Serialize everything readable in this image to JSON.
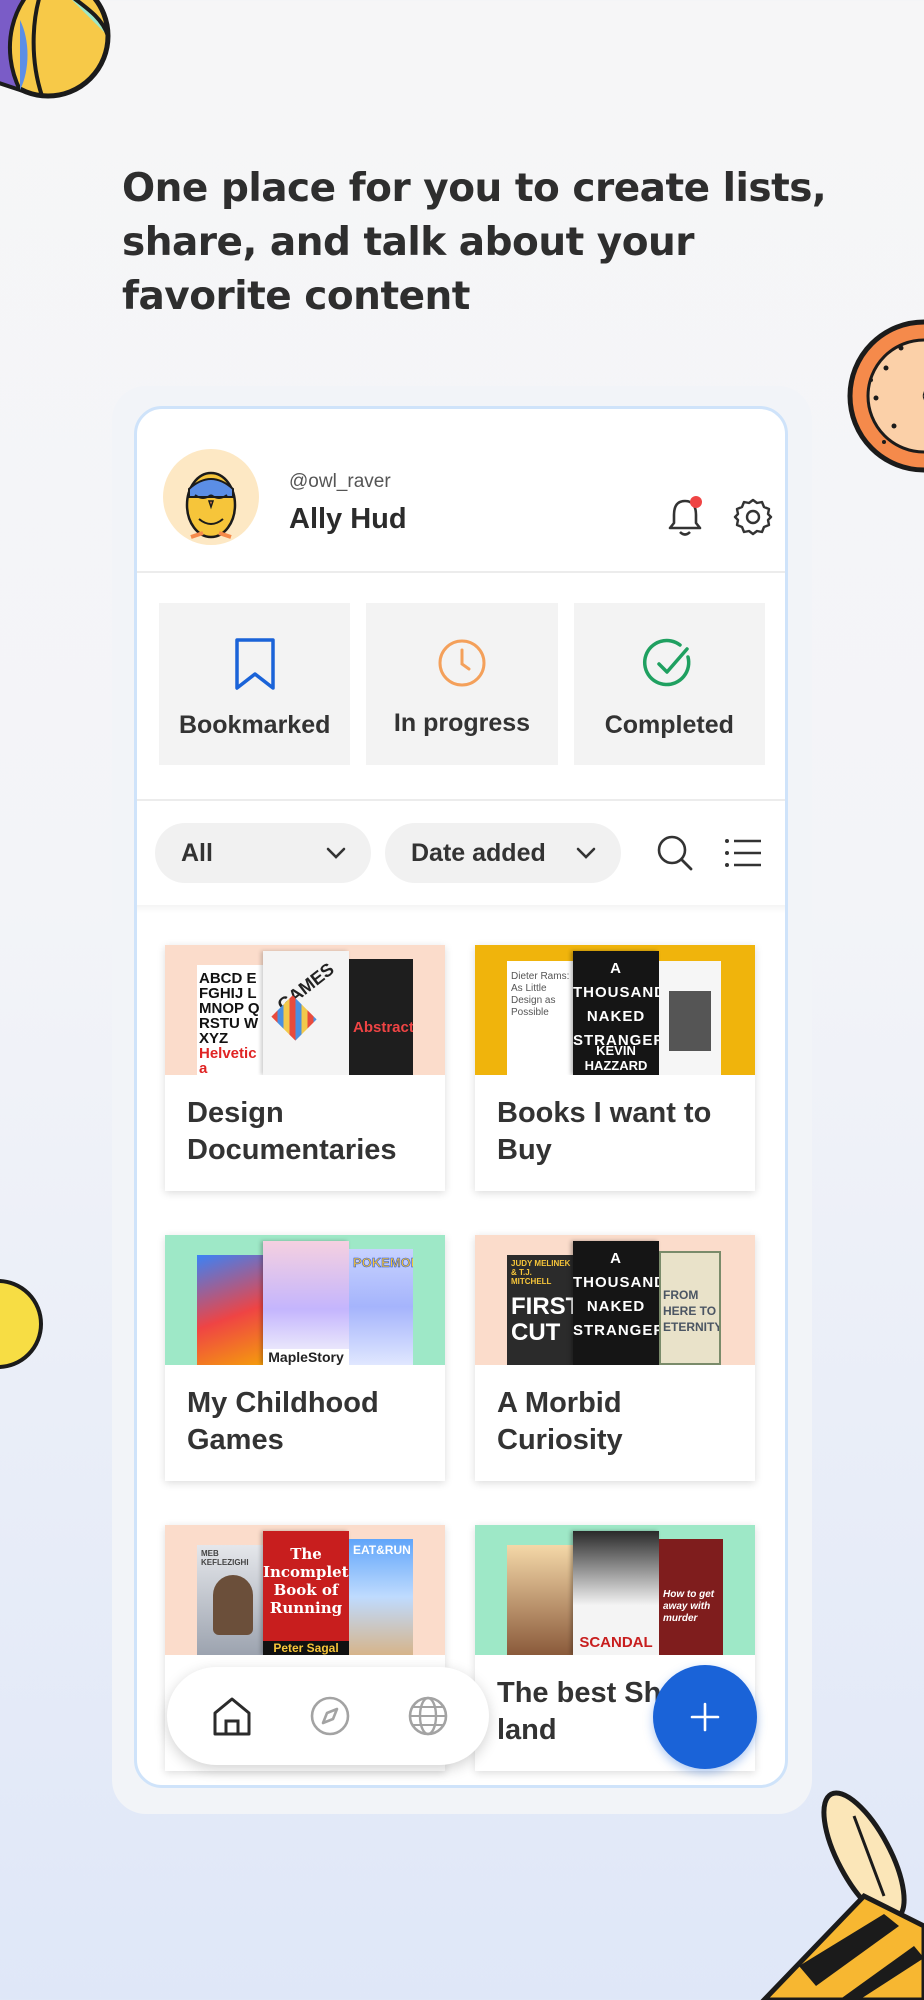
{
  "headline": "One place for you to create lists, share, and talk about your favorite content",
  "profile": {
    "handle": "@owl_raver",
    "name": "Ally Hud"
  },
  "status_cards": [
    {
      "label": "Bookmarked",
      "icon": "bookmark-icon",
      "color": "#1a63d8"
    },
    {
      "label": "In progress",
      "icon": "clock-icon",
      "color": "#f4a05a"
    },
    {
      "label": "Completed",
      "icon": "check-circle-icon",
      "color": "#1fa060"
    }
  ],
  "filters": {
    "type_value": "All",
    "sort_value": "Date added"
  },
  "lists": [
    {
      "title": "Design Documentaries",
      "cover_bg": "#fbdccb",
      "cover_texts": [
        "ABCD EFGHIJ LMNOP QRSTU WXYZ",
        "Helvetica",
        "GAMES",
        "Abstract"
      ]
    },
    {
      "title": "Books I want to Buy",
      "cover_bg": "#f0b40c",
      "cover_texts": [
        "Dieter Rams: As Little Design as Possible",
        "A THOUSAND NAKED STRANGERS",
        "KEVIN HAZZARD"
      ]
    },
    {
      "title": "My Childhood Games",
      "cover_bg": "#9ee8c7",
      "cover_texts": [
        "MapleStory",
        "POKEMON"
      ]
    },
    {
      "title": "A Morbid Curiosity",
      "cover_bg": "#fbdccb",
      "cover_texts": [
        "JUDY MELINEK & T.J. MITCHELL",
        "FIRST CUT",
        "A THOUSAND NAKED STRANGERS",
        "FROM HERE TO ETERNITY"
      ]
    },
    {
      "title": "",
      "cover_bg": "#fbdccb",
      "cover_texts": [
        "MEB KEFLEZIGHI",
        "The Incomplete Book of Running",
        "Peter Sagal",
        "EAT&RUN"
      ]
    },
    {
      "title": "The best Shonda-land",
      "cover_bg": "#9ee8c7",
      "cover_texts": [
        "SCANDAL",
        "How to get away with murder"
      ]
    }
  ],
  "colors": {
    "accent": "#1a63d8",
    "notification_dot": "#ef4444",
    "device_border": "#cfe3fa"
  },
  "nav": [
    {
      "icon": "home-icon",
      "active": true
    },
    {
      "icon": "compass-icon",
      "active": false
    },
    {
      "icon": "globe-icon",
      "active": false
    }
  ],
  "fab_icon": "plus-icon"
}
